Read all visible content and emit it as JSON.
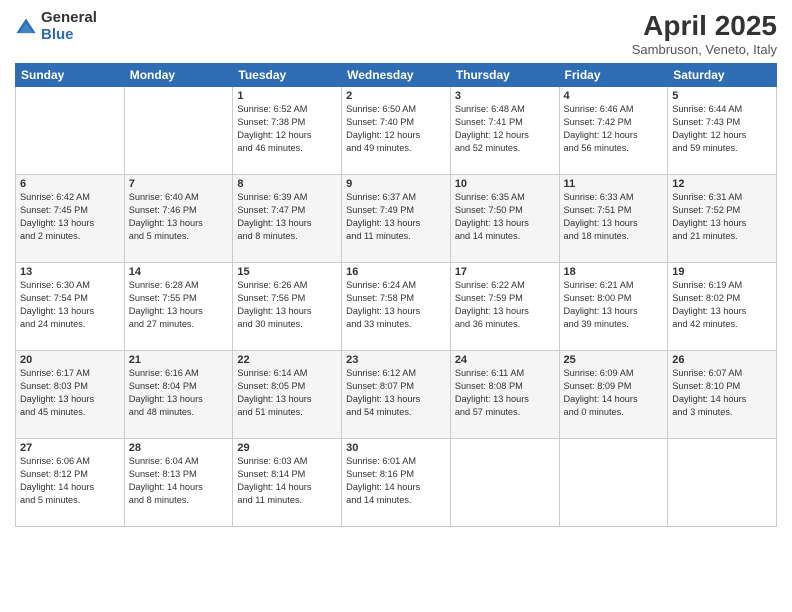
{
  "header": {
    "logo_general": "General",
    "logo_blue": "Blue",
    "title": "April 2025",
    "subtitle": "Sambruson, Veneto, Italy"
  },
  "weekdays": [
    "Sunday",
    "Monday",
    "Tuesday",
    "Wednesday",
    "Thursday",
    "Friday",
    "Saturday"
  ],
  "weeks": [
    [
      {
        "day": "",
        "info": ""
      },
      {
        "day": "",
        "info": ""
      },
      {
        "day": "1",
        "info": "Sunrise: 6:52 AM\nSunset: 7:38 PM\nDaylight: 12 hours\nand 46 minutes."
      },
      {
        "day": "2",
        "info": "Sunrise: 6:50 AM\nSunset: 7:40 PM\nDaylight: 12 hours\nand 49 minutes."
      },
      {
        "day": "3",
        "info": "Sunrise: 6:48 AM\nSunset: 7:41 PM\nDaylight: 12 hours\nand 52 minutes."
      },
      {
        "day": "4",
        "info": "Sunrise: 6:46 AM\nSunset: 7:42 PM\nDaylight: 12 hours\nand 56 minutes."
      },
      {
        "day": "5",
        "info": "Sunrise: 6:44 AM\nSunset: 7:43 PM\nDaylight: 12 hours\nand 59 minutes."
      }
    ],
    [
      {
        "day": "6",
        "info": "Sunrise: 6:42 AM\nSunset: 7:45 PM\nDaylight: 13 hours\nand 2 minutes."
      },
      {
        "day": "7",
        "info": "Sunrise: 6:40 AM\nSunset: 7:46 PM\nDaylight: 13 hours\nand 5 minutes."
      },
      {
        "day": "8",
        "info": "Sunrise: 6:39 AM\nSunset: 7:47 PM\nDaylight: 13 hours\nand 8 minutes."
      },
      {
        "day": "9",
        "info": "Sunrise: 6:37 AM\nSunset: 7:49 PM\nDaylight: 13 hours\nand 11 minutes."
      },
      {
        "day": "10",
        "info": "Sunrise: 6:35 AM\nSunset: 7:50 PM\nDaylight: 13 hours\nand 14 minutes."
      },
      {
        "day": "11",
        "info": "Sunrise: 6:33 AM\nSunset: 7:51 PM\nDaylight: 13 hours\nand 18 minutes."
      },
      {
        "day": "12",
        "info": "Sunrise: 6:31 AM\nSunset: 7:52 PM\nDaylight: 13 hours\nand 21 minutes."
      }
    ],
    [
      {
        "day": "13",
        "info": "Sunrise: 6:30 AM\nSunset: 7:54 PM\nDaylight: 13 hours\nand 24 minutes."
      },
      {
        "day": "14",
        "info": "Sunrise: 6:28 AM\nSunset: 7:55 PM\nDaylight: 13 hours\nand 27 minutes."
      },
      {
        "day": "15",
        "info": "Sunrise: 6:26 AM\nSunset: 7:56 PM\nDaylight: 13 hours\nand 30 minutes."
      },
      {
        "day": "16",
        "info": "Sunrise: 6:24 AM\nSunset: 7:58 PM\nDaylight: 13 hours\nand 33 minutes."
      },
      {
        "day": "17",
        "info": "Sunrise: 6:22 AM\nSunset: 7:59 PM\nDaylight: 13 hours\nand 36 minutes."
      },
      {
        "day": "18",
        "info": "Sunrise: 6:21 AM\nSunset: 8:00 PM\nDaylight: 13 hours\nand 39 minutes."
      },
      {
        "day": "19",
        "info": "Sunrise: 6:19 AM\nSunset: 8:02 PM\nDaylight: 13 hours\nand 42 minutes."
      }
    ],
    [
      {
        "day": "20",
        "info": "Sunrise: 6:17 AM\nSunset: 8:03 PM\nDaylight: 13 hours\nand 45 minutes."
      },
      {
        "day": "21",
        "info": "Sunrise: 6:16 AM\nSunset: 8:04 PM\nDaylight: 13 hours\nand 48 minutes."
      },
      {
        "day": "22",
        "info": "Sunrise: 6:14 AM\nSunset: 8:05 PM\nDaylight: 13 hours\nand 51 minutes."
      },
      {
        "day": "23",
        "info": "Sunrise: 6:12 AM\nSunset: 8:07 PM\nDaylight: 13 hours\nand 54 minutes."
      },
      {
        "day": "24",
        "info": "Sunrise: 6:11 AM\nSunset: 8:08 PM\nDaylight: 13 hours\nand 57 minutes."
      },
      {
        "day": "25",
        "info": "Sunrise: 6:09 AM\nSunset: 8:09 PM\nDaylight: 14 hours\nand 0 minutes."
      },
      {
        "day": "26",
        "info": "Sunrise: 6:07 AM\nSunset: 8:10 PM\nDaylight: 14 hours\nand 3 minutes."
      }
    ],
    [
      {
        "day": "27",
        "info": "Sunrise: 6:06 AM\nSunset: 8:12 PM\nDaylight: 14 hours\nand 5 minutes."
      },
      {
        "day": "28",
        "info": "Sunrise: 6:04 AM\nSunset: 8:13 PM\nDaylight: 14 hours\nand 8 minutes."
      },
      {
        "day": "29",
        "info": "Sunrise: 6:03 AM\nSunset: 8:14 PM\nDaylight: 14 hours\nand 11 minutes."
      },
      {
        "day": "30",
        "info": "Sunrise: 6:01 AM\nSunset: 8:16 PM\nDaylight: 14 hours\nand 14 minutes."
      },
      {
        "day": "",
        "info": ""
      },
      {
        "day": "",
        "info": ""
      },
      {
        "day": "",
        "info": ""
      }
    ]
  ]
}
